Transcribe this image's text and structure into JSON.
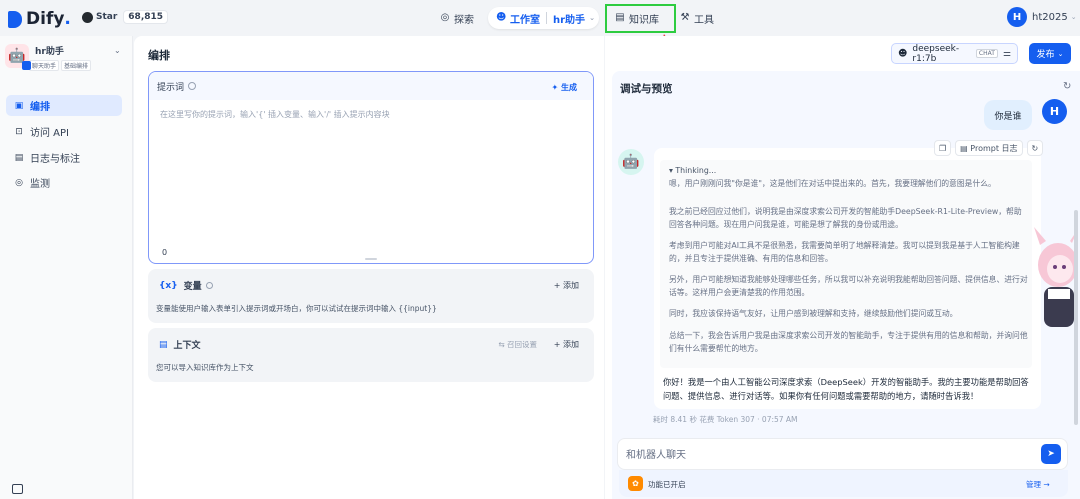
{
  "brand": {
    "name": "Dify",
    "dot": "."
  },
  "github": {
    "label": "Star",
    "count": "68,815"
  },
  "nav": {
    "explore": "探索",
    "studio": "工作室",
    "app_name": "hr助手",
    "knowledge": "知识库",
    "tools": "工具"
  },
  "user": {
    "initial": "H",
    "name": "ht2025"
  },
  "app": {
    "name": "hr助手",
    "tag1": "聊天助手",
    "tag2": "基础编排"
  },
  "sidebar": {
    "items": [
      {
        "label": "编排"
      },
      {
        "label": "访问 API"
      },
      {
        "label": "日志与标注"
      },
      {
        "label": "监测"
      }
    ]
  },
  "orchestration": {
    "title": "编排",
    "prompt": {
      "label": "提示词",
      "generate": "生成",
      "placeholder": "在这里写你的提示词，输入'{' 插入变量、输入'/' 插入提示内容块",
      "count": "0"
    },
    "variables": {
      "label": "变量",
      "add": "添加",
      "desc": "变量能使用户输入表单引入提示词或开场白，你可以试试在提示词中输入 {{input}}"
    },
    "context": {
      "label": "上下文",
      "recall": "召回设置",
      "add": "添加",
      "desc": "您可以导入知识库作为上下文"
    }
  },
  "model": {
    "name": "deepseek-r1:7b",
    "mode": "CHAT"
  },
  "publish": "发布",
  "debug": {
    "title": "调试与预览",
    "user_message": "你是谁",
    "prompt_log": "Prompt 日志",
    "thinking_header": "Thinking...",
    "thinking": [
      "嗯，用户刚刚问我\"你是谁\"，这是他们在对话中提出来的。首先，我要理解他们的意图是什么。",
      "我之前已经回应过他们，说明我是由深度求索公司开发的智能助手DeepSeek-R1-Lite-Preview，帮助回答各种问题。现在用户问我是谁，可能是想了解我的身份或用途。",
      "考虑到用户可能对AI工具不是很熟悉，我需要简单明了地解释清楚。我可以提到我是基于人工智能构建的，并且专注于提供准确、有用的信息和回答。",
      "另外，用户可能想知道我能够处理哪些任务，所以我可以补充说明我能帮助回答问题、提供信息、进行对话等。这样用户会更清楚我的作用范围。",
      "同时，我应该保持语气友好，让用户感到被理解和支持，继续鼓励他们提问或互动。",
      "总结一下，我会告诉用户我是由深度求索公司开发的智能助手，专注于提供有用的信息和帮助，并询问他们有什么需要帮忙的地方。"
    ],
    "answer": "你好！我是一个由人工智能公司深度求索（DeepSeek）开发的智能助手。我的主要功能是帮助回答问题、提供信息、进行对话等。如果你有任何问题或需要帮助的地方，请随时告诉我！",
    "meta": "耗时 8.41 秒  花费 Token 307  ·  07:57 AM",
    "input_placeholder": "和机器人聊天",
    "features": "功能已开启",
    "manage": "管理"
  },
  "colors": {
    "accent": "#155eef",
    "highlight": "#2ecc40",
    "arrow": "#e8383d"
  }
}
